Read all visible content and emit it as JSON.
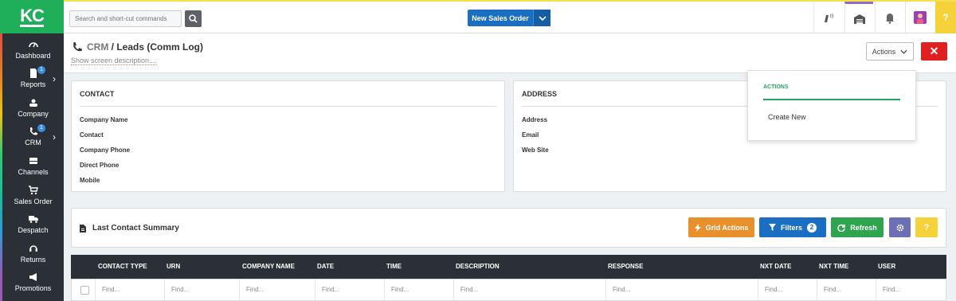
{
  "app": {
    "logo": "KC"
  },
  "sidebar": {
    "items": [
      {
        "label": "Dashboard",
        "icon": "gauge-icon",
        "badge": ""
      },
      {
        "label": "Reports",
        "icon": "document-icon",
        "badge": "1"
      },
      {
        "label": "Company",
        "icon": "users-icon",
        "badge": ""
      },
      {
        "label": "CRM",
        "icon": "phone-icon",
        "badge": "1"
      },
      {
        "label": "Channels",
        "icon": "inbox-icon",
        "badge": ""
      },
      {
        "label": "Sales Order",
        "icon": "cart-icon",
        "badge": ""
      },
      {
        "label": "Despatch",
        "icon": "truck-icon",
        "badge": ""
      },
      {
        "label": "Returns",
        "icon": "headset-icon",
        "badge": ""
      },
      {
        "label": "Promotions",
        "icon": "megaphone-icon",
        "badge": ""
      }
    ]
  },
  "topbar": {
    "search_placeholder": "Search and short-cut commands",
    "new_order_label": "New Sales Order",
    "help_label": "?"
  },
  "page": {
    "breadcrumb_root": "CRM",
    "breadcrumb_sep": " / ",
    "title": "Leads (Comm Log)",
    "description_link": "Show screen description....",
    "actions_label": "Actions",
    "close_label": "✕"
  },
  "contact": {
    "title": "CONTACT",
    "fields": [
      "Company Name",
      "Contact",
      "Company Phone",
      "Direct Phone",
      "Mobile"
    ]
  },
  "address": {
    "title": "ADDRESS",
    "fields": [
      "Address",
      "Email",
      "Web Site"
    ]
  },
  "actions_menu": {
    "header": "ACTIONS",
    "items": [
      "Create New"
    ]
  },
  "summary": {
    "title": "Last Contact Summary",
    "grid_actions_label": "Grid Actions",
    "filters_label": "Filters",
    "filters_count": "2",
    "refresh_label": "Refresh",
    "help_label": "?"
  },
  "grid": {
    "columns": [
      "CONTACT TYPE",
      "URN",
      "COMPANY NAME",
      "DATE",
      "TIME",
      "DESCRIPTION",
      "RESPONSE",
      "NXT DATE",
      "NXT TIME",
      "USER"
    ],
    "filter_placeholder": "Find..."
  },
  "colors": {
    "brand_green": "#1fae5a",
    "primary_blue": "#1b6fc2",
    "danger_red": "#e02020",
    "grid_actions_orange": "#e8912c",
    "refresh_green": "#2ea44f",
    "settings_purple": "#6c6fb4",
    "help_yellow": "#f6d23a"
  }
}
